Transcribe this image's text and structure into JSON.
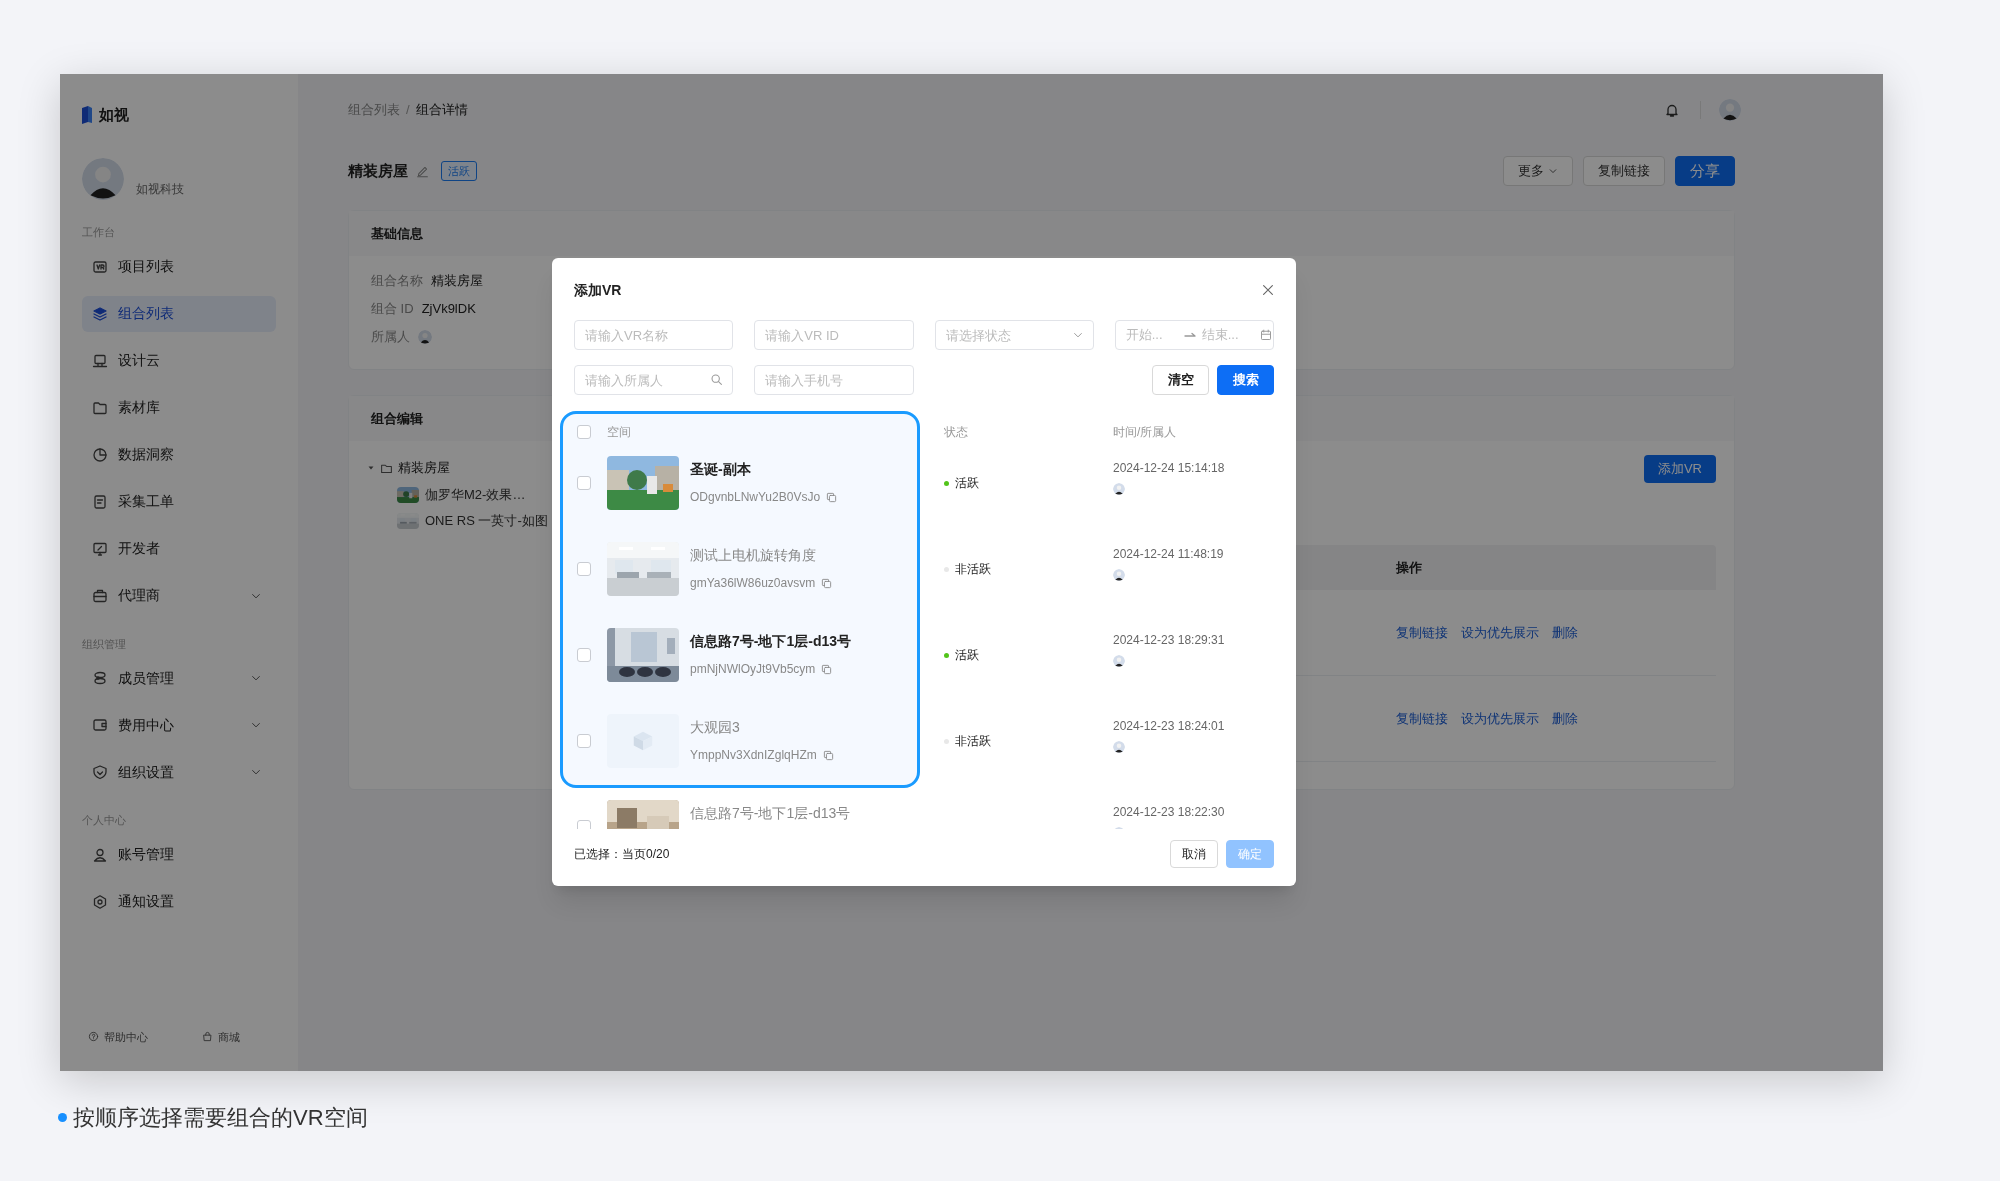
{
  "app": {
    "logo": "如视",
    "org": "如视科技",
    "sidebar": {
      "sections": [
        {
          "title": "工作台",
          "items": [
            {
              "label": "项目列表",
              "selected": false,
              "submenu": false
            },
            {
              "label": "组合列表",
              "selected": true,
              "submenu": false
            },
            {
              "label": "设计云",
              "selected": false,
              "submenu": false
            },
            {
              "label": "素材库",
              "selected": false,
              "submenu": false
            },
            {
              "label": "数据洞察",
              "selected": false,
              "submenu": false
            },
            {
              "label": "采集工单",
              "selected": false,
              "submenu": false
            },
            {
              "label": "开发者",
              "selected": false,
              "submenu": false
            },
            {
              "label": "代理商",
              "selected": false,
              "submenu": true
            }
          ]
        },
        {
          "title": "组织管理",
          "items": [
            {
              "label": "成员管理",
              "selected": false,
              "submenu": true
            },
            {
              "label": "费用中心",
              "selected": false,
              "submenu": true
            },
            {
              "label": "组织设置",
              "selected": false,
              "submenu": true
            }
          ]
        },
        {
          "title": "个人中心",
          "items": [
            {
              "label": "账号管理",
              "selected": false,
              "submenu": false
            },
            {
              "label": "通知设置",
              "selected": false,
              "submenu": false
            }
          ]
        }
      ],
      "footer": [
        "帮助中心",
        "商城"
      ]
    },
    "breadcrumb": [
      "组合列表",
      "组合详情"
    ],
    "breadcrumb_separator": "/",
    "page": {
      "title": "精装房屋",
      "tag": "活跃",
      "buttons": [
        {
          "label": "更多",
          "kind": "dropdown"
        },
        {
          "label": "复制链接",
          "kind": "default"
        },
        {
          "label": "分享",
          "kind": "primary"
        }
      ]
    },
    "basic_info": {
      "title": "基础信息",
      "fields": [
        {
          "label": "组合名称",
          "value": "精装房屋",
          "kind": "text"
        },
        {
          "label": "组合 ID",
          "value": "ZjVk9lDK",
          "kind": "text"
        },
        {
          "label": "所属人",
          "kind": "avatar"
        }
      ]
    },
    "editor": {
      "title": "组合编辑",
      "add_button": "添加VR",
      "tree": [
        {
          "label": "精装房屋",
          "expanded": true,
          "children": [
            {
              "label": "伽罗华M2-效果…"
            },
            {
              "label": "ONE RS 一英寸-如图"
            }
          ]
        }
      ],
      "table": {
        "column": "操作",
        "rows": [
          {
            "actions": [
              "复制链接",
              "设为优先展示",
              "删除"
            ]
          },
          {
            "actions": [
              "复制链接",
              "设为优先展示",
              "删除"
            ]
          }
        ]
      }
    }
  },
  "dialog": {
    "title": "添加VR",
    "filters": [
      {
        "kind": "text",
        "placeholder": "请输入VR名称"
      },
      {
        "kind": "text",
        "placeholder": "请输入VR ID"
      },
      {
        "kind": "select",
        "placeholder": "请选择状态"
      },
      {
        "kind": "daterange",
        "start_placeholder": "开始...",
        "end_placeholder": "结束..."
      },
      {
        "kind": "search",
        "placeholder": "请输入所属人"
      },
      {
        "kind": "text",
        "placeholder": "请输入手机号"
      }
    ],
    "actions": [
      {
        "label": "清空",
        "kind": "default"
      },
      {
        "label": "搜索",
        "kind": "primary"
      }
    ],
    "select_all": {
      "checked": false
    },
    "columns": [
      {
        "label": "空间",
        "highlighted": true
      },
      {
        "label": "状态",
        "highlighted": false
      },
      {
        "label": "时间/所属人",
        "highlighted": false
      }
    ],
    "rows": [
      {
        "checked": false,
        "name": "圣诞-副本",
        "vr_id": "ODgvnbLNwYu2B0VsJo",
        "active": true,
        "status": "活跃",
        "time": "2024-12-24 15:14:18"
      },
      {
        "checked": false,
        "name": "测试上电机旋转角度",
        "vr_id": "gmYa36lW86uz0avsvm",
        "active": false,
        "status": "非活跃",
        "time": "2024-12-24 11:48:19"
      },
      {
        "checked": false,
        "name": "信息路7号-地下1层-d13号",
        "vr_id": "pmNjNWlOyJt9Vb5cym",
        "active": true,
        "status": "活跃",
        "time": "2024-12-23 18:29:31"
      },
      {
        "checked": false,
        "thumbnail": {
          "kind": "placeholder"
        },
        "name": "大观园3",
        "vr_id": "YmppNv3XdnIZglqHZm",
        "active": false,
        "status": "非活跃",
        "time": "2024-12-23 18:24:01"
      },
      {
        "checked": false,
        "name": "信息路7号-地下1层-d13号",
        "time": "2024-12-23 18:22:30"
      }
    ],
    "selection": "已选择：当页0/20",
    "buttons": [
      {
        "label": "取消",
        "kind": "default",
        "disabled": false
      },
      {
        "label": "确定",
        "kind": "primary",
        "disabled": true
      }
    ]
  },
  "caption": "按顺序选择需要组合的VR空间"
}
